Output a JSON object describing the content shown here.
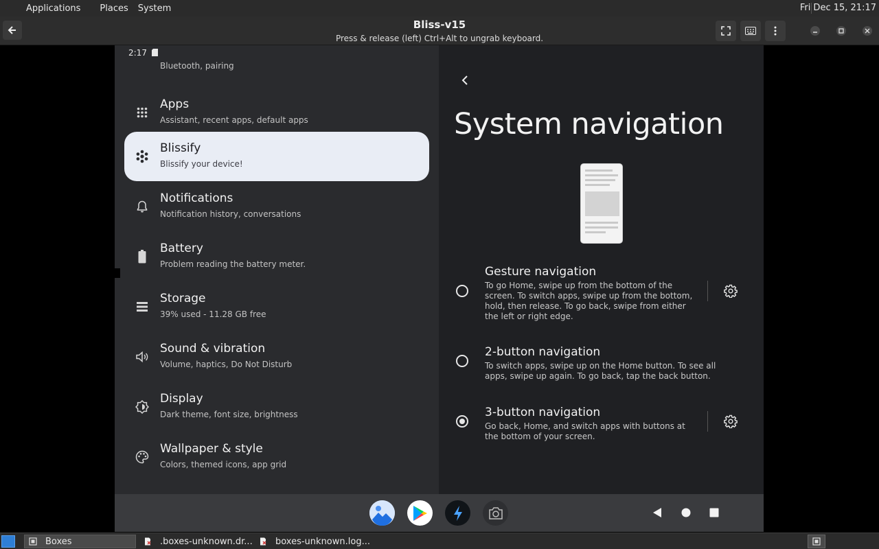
{
  "top_panel": {
    "menus": [
      "Applications",
      "Places",
      "System"
    ],
    "clock": "Fri Dec 15, 21:17"
  },
  "titlebar": {
    "title": "Bliss-v15",
    "subtitle": "Press & release (left) Ctrl+Alt to ungrab keyboard."
  },
  "android": {
    "status_time": "2:17",
    "settings_partial_subtitle": "Bluetooth, pairing",
    "settings_items": [
      {
        "title": "Apps",
        "subtitle": "Assistant, recent apps, default apps",
        "icon": "apps-grid-icon"
      },
      {
        "title": "Blissify",
        "subtitle": "Blissify your device!",
        "icon": "flower-icon"
      },
      {
        "title": "Notifications",
        "subtitle": "Notification history, conversations",
        "icon": "bell-icon"
      },
      {
        "title": "Battery",
        "subtitle": "Problem reading the battery meter.",
        "icon": "battery-icon"
      },
      {
        "title": "Storage",
        "subtitle": "39% used - 11.28 GB free",
        "icon": "storage-icon"
      },
      {
        "title": "Sound & vibration",
        "subtitle": "Volume, haptics, Do Not Disturb",
        "icon": "speaker-icon"
      },
      {
        "title": "Display",
        "subtitle": "Dark theme, font size, brightness",
        "icon": "brightness-icon"
      },
      {
        "title": "Wallpaper & style",
        "subtitle": "Colors, themed icons, app grid",
        "icon": "palette-icon"
      }
    ],
    "selected_item": "Blissify",
    "page_title": "System navigation",
    "nav_options": [
      {
        "title": "Gesture navigation",
        "desc": "To go Home, swipe up from the bottom of the screen. To switch apps, swipe up from the bottom, hold, then release. To go back, swipe from either the left or right edge.",
        "selected": false
      },
      {
        "title": "2-button navigation",
        "desc": "To switch apps, swipe up on the Home button. To see all apps, swipe up again. To go back, tap the back button.",
        "selected": false
      },
      {
        "title": "3-button navigation",
        "desc": "Go back, Home, and switch apps with buttons at the bottom of your screen.",
        "selected": true
      }
    ]
  },
  "taskbar": {
    "tasks": [
      "Boxes",
      ".boxes-unknown.dr...",
      "boxes-unknown.log..."
    ]
  },
  "colors": {
    "selected_item_bg": "#e9edf5",
    "left_pane_bg": "#2a2b2e",
    "right_pane_bg": "#1f2023",
    "dock_bg": "#3a3b3e"
  }
}
